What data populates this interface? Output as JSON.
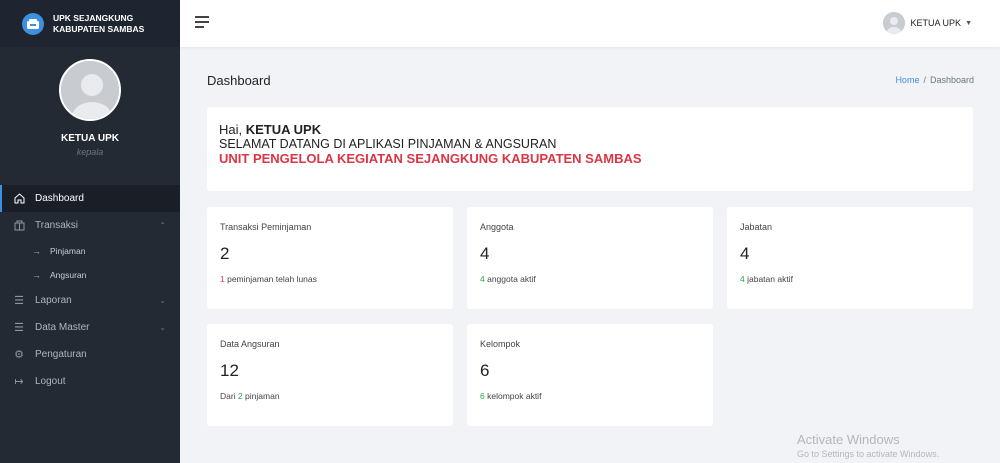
{
  "brand": {
    "line1": "UPK SEJANGKUNG",
    "line2": "KABUPATEN SAMBAS"
  },
  "profile": {
    "name": "KETUA UPK",
    "role": "kepala"
  },
  "sidebar": {
    "items": [
      {
        "label": "Dashboard",
        "icon": "home-icon",
        "active": true
      },
      {
        "label": "Transaksi",
        "icon": "transaction-icon"
      },
      {
        "label": "Pinjaman",
        "icon": "arrow-right-icon"
      },
      {
        "label": "Angsuran",
        "icon": "arrow-right-icon"
      },
      {
        "label": "Laporan",
        "icon": "list-icon"
      },
      {
        "label": "Data Master",
        "icon": "list-icon"
      },
      {
        "label": "Pengaturan",
        "icon": "gear-icon"
      },
      {
        "label": "Logout",
        "icon": "logout-icon"
      }
    ]
  },
  "topbar": {
    "user_name": "KETUA UPK"
  },
  "page": {
    "title": "Dashboard",
    "breadcrumb_home": "Home",
    "breadcrumb_sep": "/",
    "breadcrumb_current": "Dashboard"
  },
  "welcome": {
    "greeting": "Hai,",
    "name": "KETUA UPK",
    "line2": "SELAMAT DATANG DI APLIKASI PINJAMAN & ANGSURAN",
    "line3": "UNIT PENGELOLA KEGIATAN SEJANGKUNG KABUPATEN SAMBAS"
  },
  "cards": [
    {
      "title": "Transaksi Peminjaman",
      "value": "2",
      "foot_num": "1",
      "foot_text": " peminjaman telah lunas"
    },
    {
      "title": "Anggota",
      "value": "4",
      "foot_num": "4",
      "foot_text": " anggota aktif"
    },
    {
      "title": "Jabatan",
      "value": "4",
      "foot_num": "4",
      "foot_text": " jabatan aktif"
    },
    {
      "title": "Data Angsuran",
      "value": "12",
      "foot_pre": "Dari ",
      "foot_num": "2",
      "foot_text": " pinjaman"
    },
    {
      "title": "Kelompok",
      "value": "6",
      "foot_num": "6",
      "foot_text": " kelompok aktif"
    }
  ],
  "watermark": {
    "line1": "Activate Windows",
    "line2": "Go to Settings to activate Windows."
  },
  "colors": {
    "sidebar_bg": "#242a33",
    "accent": "#3d8fe0",
    "danger": "#dc3545",
    "success": "#28a745"
  }
}
